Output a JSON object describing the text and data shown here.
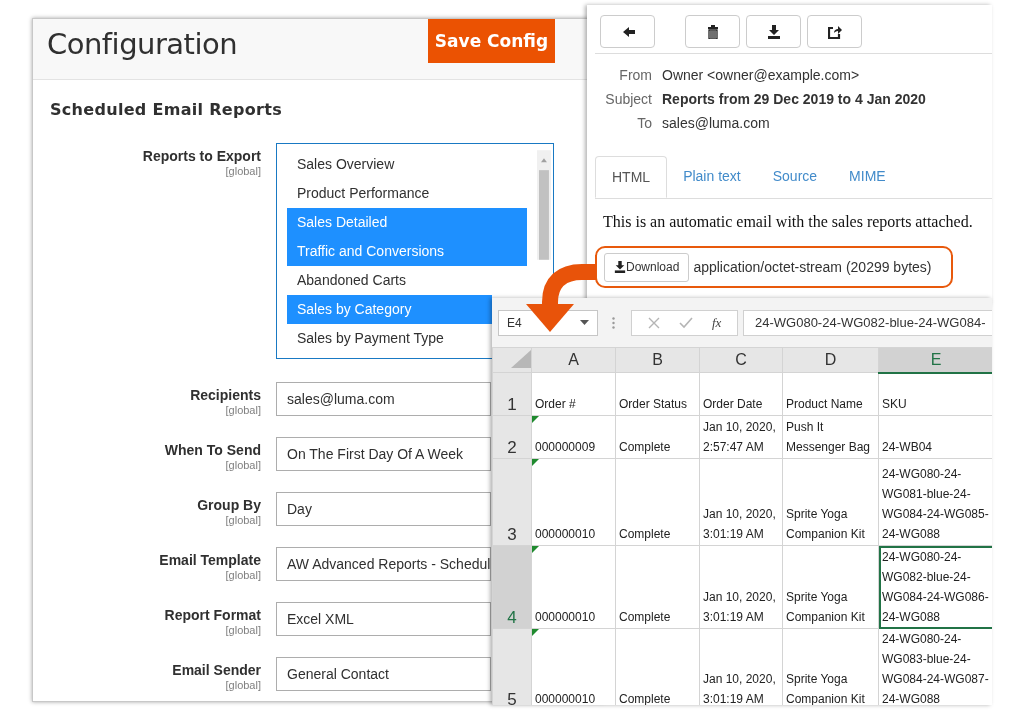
{
  "config": {
    "title": "Configuration",
    "save_button": "Save Config",
    "section_title": "Scheduled Email Reports",
    "fields": [
      {
        "kind": "multiselect",
        "label": "Reports to Export",
        "scope": "[global]",
        "options": [
          {
            "label": "Sales Overview",
            "selected": false
          },
          {
            "label": "Product Performance",
            "selected": false
          },
          {
            "label": "Sales Detailed",
            "selected": true
          },
          {
            "label": "Traffic and Conversions",
            "selected": true
          },
          {
            "label": "Abandoned Carts",
            "selected": false
          },
          {
            "label": "Sales by Category",
            "selected": true
          },
          {
            "label": "Sales by Payment Type",
            "selected": false
          }
        ]
      },
      {
        "kind": "input",
        "label": "Recipients",
        "scope": "[global]",
        "value": "sales@luma.com"
      },
      {
        "kind": "input",
        "label": "When To Send",
        "scope": "[global]",
        "value": "On The First Day Of A Week"
      },
      {
        "kind": "input",
        "label": "Group By",
        "scope": "[global]",
        "value": "Day"
      },
      {
        "kind": "input",
        "label": "Email Template",
        "scope": "[global]",
        "value": "AW Advanced Reports - Schedul"
      },
      {
        "kind": "input",
        "label": "Report Format",
        "scope": "[global]",
        "value": "Excel XML"
      },
      {
        "kind": "input",
        "label": "Email Sender",
        "scope": "[global]",
        "value": "General Contact"
      }
    ]
  },
  "email": {
    "toolbar": [
      {
        "kind": "back"
      },
      {
        "kind": "delete"
      },
      {
        "kind": "download"
      },
      {
        "kind": "forward"
      }
    ],
    "headers": [
      {
        "label": "From",
        "value": "Owner <owner@example.com>",
        "emphasized": false
      },
      {
        "label": "Subject",
        "value": "Reports from 29 Dec 2019 to 4 Jan 2020",
        "emphasized": true
      },
      {
        "label": "To",
        "value": "sales@luma.com",
        "emphasized": false
      }
    ],
    "tabs": [
      {
        "label": "HTML",
        "selected": true
      },
      {
        "label": "Plain text",
        "selected": false
      },
      {
        "label": "Source",
        "selected": false
      },
      {
        "label": "MIME",
        "selected": false
      }
    ],
    "body": "This is an automatic email with the sales reports attached.",
    "attachment": {
      "button": "Download",
      "description": "application/octet-stream (20299 bytes)"
    }
  },
  "spreadsheet": {
    "name_box": "E4",
    "function_label": "fx",
    "formula": "24-WG080-24-WG082-blue-24-WG084-",
    "columns": [
      {
        "label": "A",
        "selected": false
      },
      {
        "label": "B",
        "selected": false
      },
      {
        "label": "C",
        "selected": false
      },
      {
        "label": "D",
        "selected": false
      },
      {
        "label": "E",
        "selected": true
      }
    ],
    "rows": [
      {
        "number": "1",
        "selected": false,
        "flagged": false,
        "cells": [
          "Order #",
          "Order Status",
          "Order Date",
          "Product Name",
          "SKU"
        ]
      },
      {
        "number": "2",
        "selected": false,
        "flagged": true,
        "cells": [
          "000000009",
          "Complete",
          "Jan 10, 2020, 2:57:47 AM",
          "Push It Messenger Bag",
          "24-WB04"
        ]
      },
      {
        "number": "3",
        "selected": false,
        "flagged": true,
        "cells": [
          "000000010",
          "Complete",
          "Jan 10, 2020, 3:01:19 AM",
          "Sprite Yoga Companion Kit",
          "24-WG080-24-WG081-blue-24-WG084-24-WG085-24-WG088"
        ]
      },
      {
        "number": "4",
        "selected": true,
        "flagged": true,
        "cells": [
          "000000010",
          "Complete",
          "Jan 10, 2020, 3:01:19 AM",
          "Sprite Yoga Companion Kit",
          "24-WG080-24-WG082-blue-24-WG084-24-WG086-24-WG088"
        ]
      },
      {
        "number": "5",
        "selected": false,
        "flagged": true,
        "cells": [
          "000000010",
          "Complete",
          "Jan 10, 2020, 3:01:19 AM",
          "Sprite Yoga Companion Kit",
          "24-WG080-24-WG083-blue-24-WG084-24-WG087-24-WG088"
        ]
      }
    ]
  }
}
